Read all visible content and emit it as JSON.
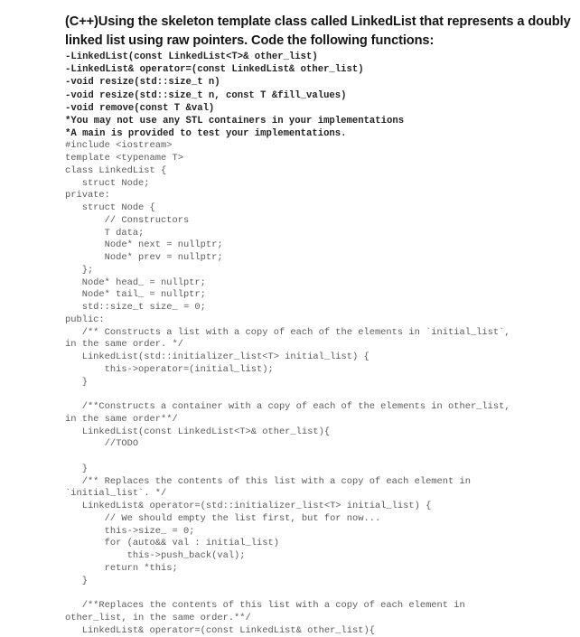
{
  "question": {
    "title": "(C++)Using the skeleton template class called LinkedList that represents a doubly linked list using raw pointers. Code the following functions:",
    "requirements": [
      "-LinkedList(const LinkedList<T>& other_list)",
      "-LinkedList& operator=(const LinkedList& other_list)",
      "-void resize(std::size_t n)",
      "-void resize(std::size_t n, const T &fill_values)",
      "-void remove(const T &val)",
      "*You may not use any STL containers in your implementations",
      "*A main is provided to test your implementations."
    ]
  },
  "code": {
    "lines": [
      "#include <iostream>",
      "template <typename T>",
      "class LinkedList {",
      "   struct Node;",
      "private:",
      "   struct Node {",
      "       // Constructors",
      "       T data;",
      "       Node* next = nullptr;",
      "       Node* prev = nullptr;",
      "   };",
      "   Node* head_ = nullptr;",
      "   Node* tail_ = nullptr;",
      "   std::size_t size_ = 0;",
      "public:",
      "   /** Constructs a list with a copy of each of the elements in `initial_list`,",
      "in the same order. */",
      "   LinkedList(std::initializer_list<T> initial_list) {",
      "       this->operator=(initial_list);",
      "   }",
      "",
      "   /**Constructs a container with a copy of each of the elements in other_list,",
      "in the same order**/",
      "   LinkedList(const LinkedList<T>& other_list){",
      "       //TODO",
      "",
      "   }",
      "   /** Replaces the contents of this list with a copy of each element in",
      "`initial_list`. */",
      "   LinkedList& operator=(std::initializer_list<T> initial_list) {",
      "       // We should empty the list first, but for now...",
      "       this->size_ = 0;",
      "       for (auto&& val : initial_list)",
      "           this->push_back(val);",
      "       return *this;",
      "   }",
      "",
      "   /**Replaces the contents of this list with a copy of each element in",
      "other_list, in the same order.**/",
      "   LinkedList& operator=(const LinkedList& other_list){"
    ]
  }
}
